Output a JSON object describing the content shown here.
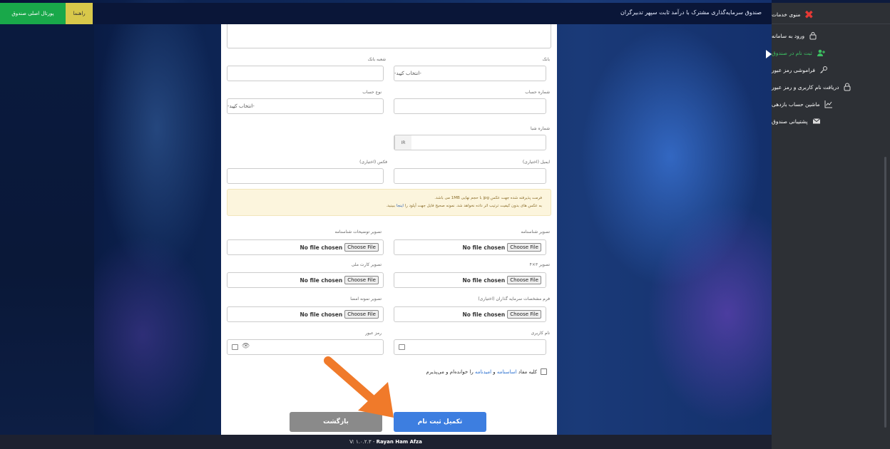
{
  "app": {
    "title": "صندوق سرمایه‌گذاری مشترک با درآمد ثابت سپهر تدبیرگران",
    "portal_btn": "پورتال اصلی صندوق",
    "guide_btn": "راهنما"
  },
  "sidebar": {
    "menu_label": "منوی خدمات",
    "items": [
      {
        "label": "ورود به سامانه",
        "icon": "lock-icon"
      },
      {
        "label": "ثبت نام در صندوق",
        "icon": "add-user-icon",
        "active": true
      },
      {
        "label": "فراموشی رمز عبور",
        "icon": "key-icon"
      },
      {
        "label": "دریافت نام کاربری و رمز عبور",
        "icon": "lock-outline-icon"
      },
      {
        "label": "ماشین حساب بازدهی",
        "icon": "chart-icon"
      },
      {
        "label": "پشتیبانی صندوق",
        "icon": "mail-icon"
      }
    ]
  },
  "form": {
    "bank_label": "بانک",
    "bank_select": "-انتخاب کنید-",
    "branch_label": "شعبه بانک",
    "account_no_label": "شماره حساب",
    "account_type_label": "نوع حساب",
    "account_type_select": "-انتخاب کنید-",
    "sheba_label": "شماره شبا",
    "sheba_prefix": "IR",
    "email_label": "ایمیل (اختیاری)",
    "fax_label": "فکس (اختیاری)",
    "warning_line1": "فرمت پذیرفته شده جهت عکس jpg با حجم نهایی 1MB می باشد.",
    "warning_line2_pre": "به عکس های بدون کیفیت ترتیب اثر داده نخواهد شد. نمونه صحیح فایل جهت آپلود را ",
    "warning_link": "اینجا",
    "warning_line2_post": " ببینید.",
    "file_btn": "Choose File",
    "file_none": "No file chosen",
    "id_photo_label": "تصویر شناسنامه",
    "id_desc_label": "تصویر توضیحات شناسنامه",
    "personal_photo_label": "تصویر ۳×۴",
    "national_card_label": "تصویر کارت ملی",
    "investor_form_label": "فرم مشخصات سرمایه گذاران (اختیاری)",
    "signature_label": "تصویر نمونه امضا",
    "username_label": "نام کاربری",
    "password_label": "رمز عبور",
    "agree_pre": "کلیه مفاد",
    "agree_link1": "اساسنامه",
    "agree_mid": "و",
    "agree_link2": "امیدنامه",
    "agree_post": "را خوانده‌ام و می‌پذیرم",
    "submit_btn": "تکمیل ثبت نام",
    "back_btn": "بازگشت"
  },
  "footer": {
    "version": "V: ۱.۰.۲.۳ -",
    "company": "Rayan Ham Afza"
  },
  "colors": {
    "accent": "#3d7ee0",
    "sidebar_bg": "#2d3035",
    "active_green": "#3cc062",
    "arrow_orange": "#f07a2a"
  }
}
